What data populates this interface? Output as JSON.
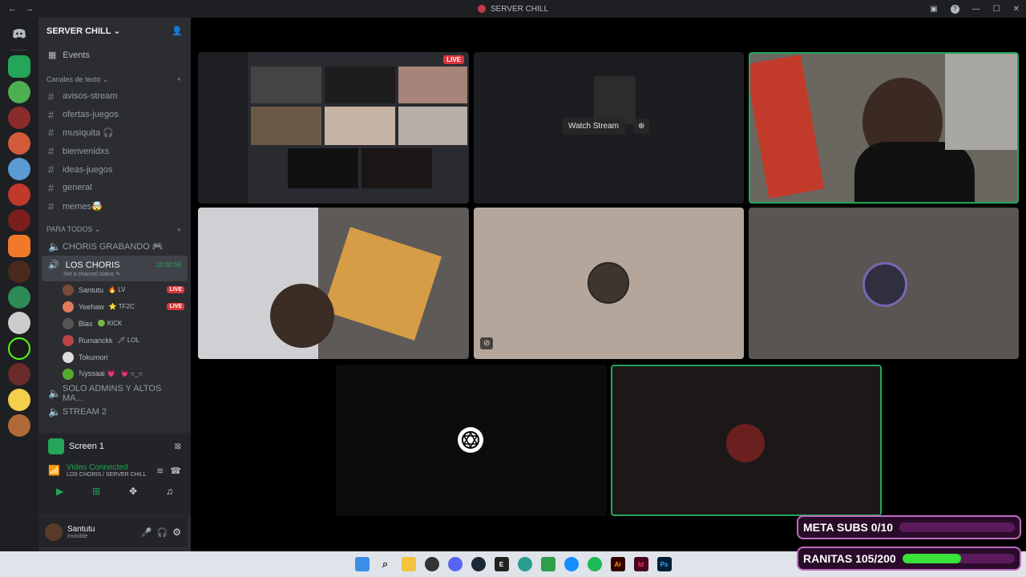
{
  "window": {
    "title": "SERVER CHILL"
  },
  "server": {
    "name": "SERVER CHILL"
  },
  "sidebar": {
    "events_label": "Events",
    "text_category": "Canales de texto",
    "text_channels": [
      "avisos-stream",
      "ofertas-juegos",
      "musiquita 🎧",
      "bienvenidxs",
      "ideas-juegos",
      "general",
      "memes🤯"
    ],
    "voice_category": "PARA TODOS",
    "voice_channels": {
      "grabando": "CHORIS GRABANDO 🎮",
      "active": {
        "name": "LOS CHORIS",
        "timer": "10:00:59",
        "status": "Set a channel status ✎"
      },
      "members": [
        {
          "name": "Santutu",
          "tag": "🔥 LV",
          "live": "LIVE",
          "color": "#7a4a3a"
        },
        {
          "name": "Yeehaw",
          "tag": "⭐ TF2C",
          "live": "LIVE",
          "color": "#e07a5a"
        },
        {
          "name": "Blas",
          "tag": "🟢 KICK",
          "live": "",
          "color": "#555"
        },
        {
          "name": "Rumanckk",
          "tag": "🗡 LOL",
          "live": "",
          "color": "#b44"
        },
        {
          "name": "Tokumori",
          "tag": "",
          "live": "",
          "color": "#ddd"
        },
        {
          "name": "ℕyssaai 💗",
          "tag": "💗 ෆ_ෆ",
          "live": "",
          "color": "#5a3"
        }
      ],
      "solo_admins": "SOLO ADMINS Y ALTOS MA...",
      "stream2": "STREAM 2"
    }
  },
  "voice_panel": {
    "screen_label": "Screen 1",
    "connected": "Video Connected",
    "location": "LOS CHORIS / SERVER CHILL"
  },
  "user_panel": {
    "name": "Santutu",
    "status": "Invisible"
  },
  "stage": {
    "live_badge": "LIVE",
    "watch_stream": "Watch Stream"
  },
  "overlay": {
    "subs_label": "META SUBS 0/10",
    "subs_progress": 0,
    "ranitas_label": "RANITAS 105/200",
    "ranitas_progress": 0.525
  },
  "colors": {
    "accent": "#23a55a",
    "live": "#da373c",
    "overlay_border": "#c06cc0",
    "progress": "#39e33a"
  }
}
